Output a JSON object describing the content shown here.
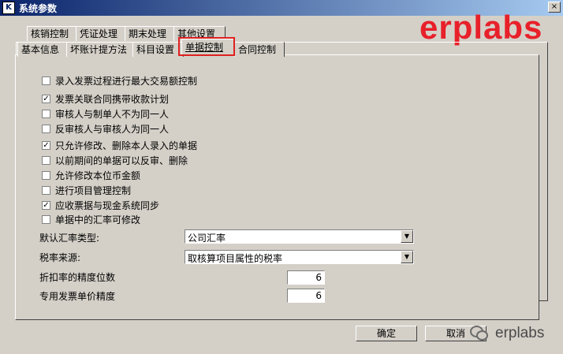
{
  "window": {
    "title": "系统参数",
    "close_glyph": "×"
  },
  "watermark": {
    "text": "erplabs",
    "footer_text": "erplabs"
  },
  "tabs_row1": [
    "核销控制",
    "凭证处理",
    "期末处理",
    "其他设置"
  ],
  "tabs_row2": [
    "基本信息",
    "坏账计提方法",
    "科目设置",
    "单据控制",
    "合同控制"
  ],
  "active_tab": "单据控制",
  "options": [
    {
      "label": "录入发票过程进行最大交易额控制",
      "checked": false
    },
    {
      "label": "发票关联合同携带收款计划",
      "checked": true
    },
    {
      "label": "审核人与制单人不为同一人",
      "checked": false
    },
    {
      "label": "反审核人与审核人为同一人",
      "checked": false
    },
    {
      "label": "只允许修改、删除本人录入的单据",
      "checked": true
    },
    {
      "label": "以前期间的单据可以反审、删除",
      "checked": false
    },
    {
      "label": "允许修改本位币金额",
      "checked": false
    },
    {
      "label": "进行项目管理控制",
      "checked": false
    },
    {
      "label": "应收票据与现金系统同步",
      "checked": true
    },
    {
      "label": "单据中的汇率可修改",
      "checked": false
    }
  ],
  "fields": {
    "rate_type_label": "默认汇率类型:",
    "rate_type_value": "公司汇率",
    "tax_source_label": "税率来源:",
    "tax_source_value": "取核算项目属性的税率",
    "discount_precision_label": "折扣率的精度位数",
    "discount_precision_value": "6",
    "price_precision_label": "专用发票单价精度",
    "price_precision_value": "6"
  },
  "buttons": {
    "ok": "确定",
    "cancel": "取消"
  },
  "colors": {
    "watermark_red": "#e8202a",
    "highlight_red": "#e02020",
    "face": "#d4d0c8"
  }
}
